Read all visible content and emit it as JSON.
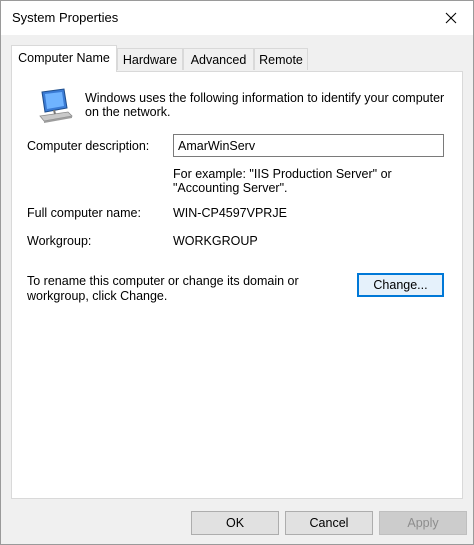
{
  "window": {
    "title": "System Properties"
  },
  "tabs": [
    {
      "label": "Computer Name",
      "active": true
    },
    {
      "label": "Hardware",
      "active": false
    },
    {
      "label": "Advanced",
      "active": false
    },
    {
      "label": "Remote",
      "active": false
    }
  ],
  "computer_name": {
    "intro": "Windows uses the following information to identify your computer on the network.",
    "description_label": "Computer description:",
    "description_value": "AmarWinServ",
    "example": "For example: \"IIS Production Server\" or \"Accounting Server\".",
    "full_name_label": "Full computer name:",
    "full_name_value": "WIN-CP4597VPRJE",
    "workgroup_label": "Workgroup:",
    "workgroup_value": "WORKGROUP",
    "rename_text": "To rename this computer or change its domain or workgroup, click Change.",
    "change_label": "Change..."
  },
  "buttons": {
    "ok": "OK",
    "cancel": "Cancel",
    "apply": "Apply"
  },
  "icons": {
    "close": "close-icon",
    "computer": "computer-icon"
  },
  "colors": {
    "accent": "#0078d7",
    "window_bg": "#f0f0f0",
    "panel_bg": "#ffffff"
  }
}
